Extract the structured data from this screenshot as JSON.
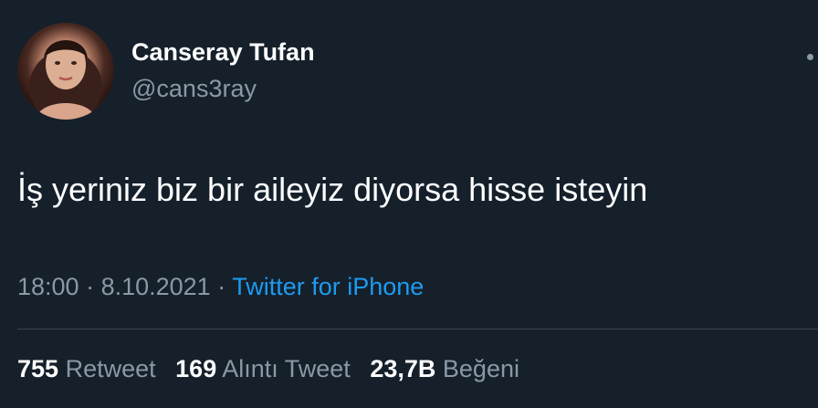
{
  "author": {
    "display_name": "Canseray Tufan",
    "handle": "@cans3ray",
    "avatar_icon": "profile-photo"
  },
  "tweet": {
    "text": "İş yeriniz biz bir aileyiz diyorsa hisse isteyin"
  },
  "meta": {
    "time": "18:00",
    "separator1": " · ",
    "date": "8.10.2021",
    "separator2": " · ",
    "source": "Twitter for iPhone"
  },
  "stats": {
    "retweets": {
      "count": "755",
      "label": "Retweet"
    },
    "quotes": {
      "count": "169",
      "label": "Alıntı Tweet"
    },
    "likes": {
      "count": "23,7B",
      "label": "Beğeni"
    }
  },
  "colors": {
    "background": "#15202b",
    "primary_text": "#ffffff",
    "secondary_text": "#8b98a5",
    "link": "#1d9bf0",
    "divider": "#38444d"
  },
  "icons": {
    "more": "more-dots-icon"
  }
}
